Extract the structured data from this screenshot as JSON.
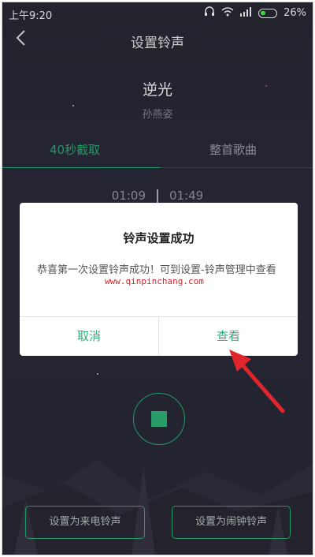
{
  "statusbar": {
    "time": "上午9:20",
    "battery": "26%"
  },
  "header": {
    "title": "设置铃声"
  },
  "song": {
    "title": "逆光",
    "artist": "孙燕姿"
  },
  "tabs": [
    {
      "label": "40秒截取"
    },
    {
      "label": "整首歌曲"
    }
  ],
  "clip": {
    "start": "01:09",
    "end": "01:49"
  },
  "dialog": {
    "title": "铃声设置成功",
    "message": "恭喜第一次设置铃声成功！可到设置-铃声管理中查看",
    "watermark": "www.qinpinchang.com",
    "cancel_label": "取消",
    "view_label": "查看"
  },
  "buttons": {
    "call_ringtone": "设置为来电铃声",
    "alarm_ringtone": "设置为闹钟铃声"
  },
  "colors": {
    "accent": "#29b47a",
    "background": "#2b2b38",
    "arrow": "#e0262d"
  }
}
